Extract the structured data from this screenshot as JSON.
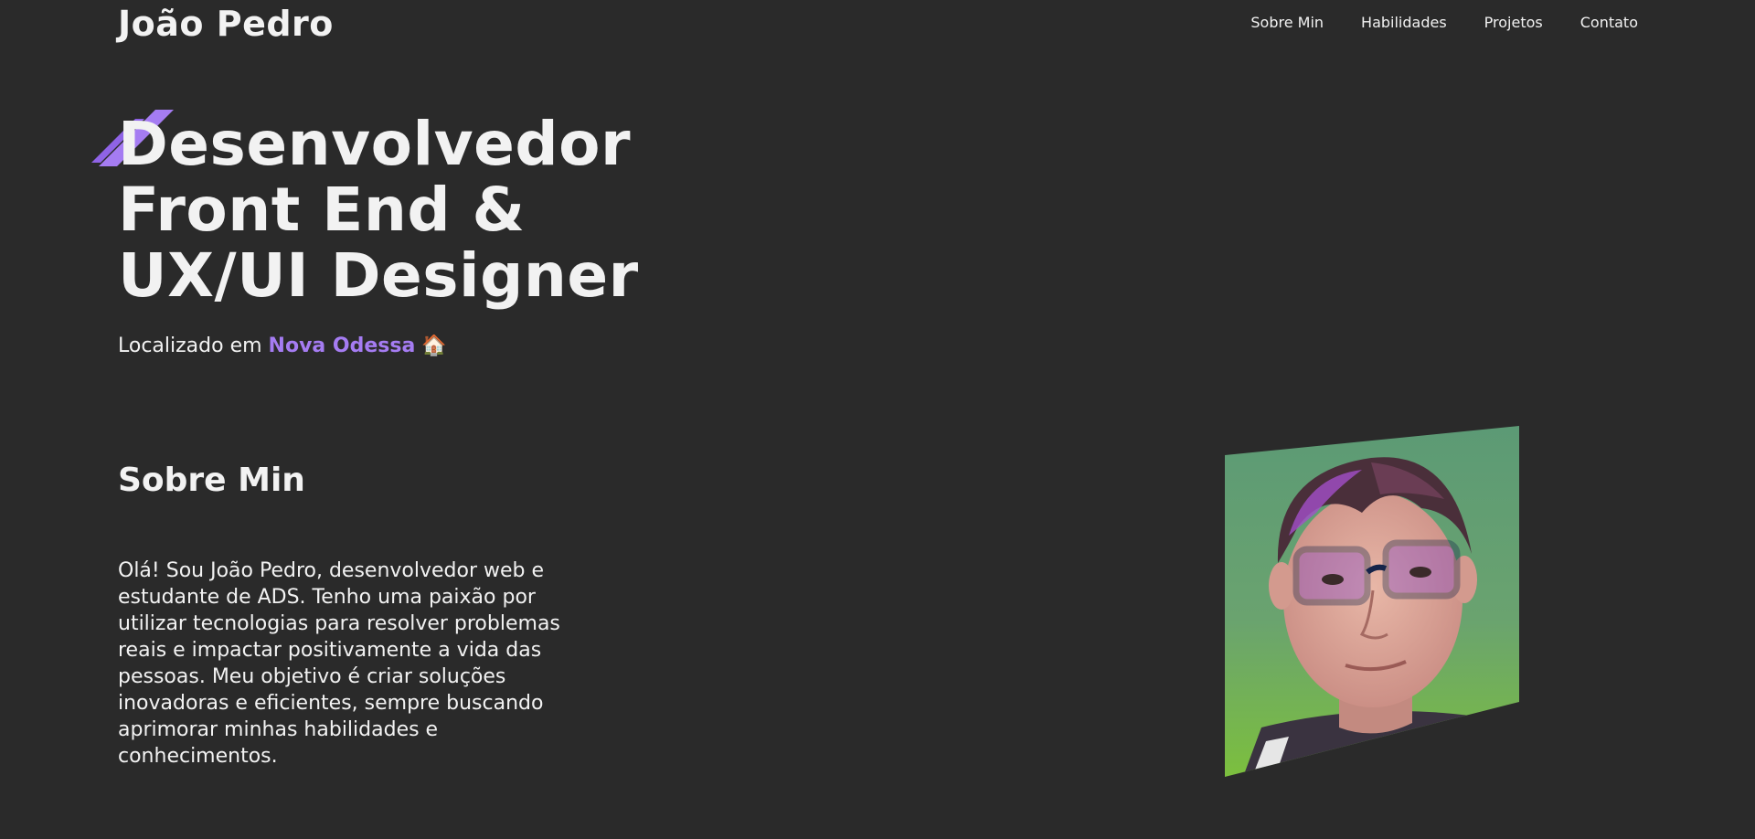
{
  "header": {
    "logo": "João Pedro",
    "nav": [
      {
        "label": "Sobre Min"
      },
      {
        "label": "Habilidades"
      },
      {
        "label": "Projetos"
      },
      {
        "label": "Contato"
      }
    ]
  },
  "hero": {
    "title_lines": [
      "Desenvolvedor",
      "Front End &",
      "UX/UI Designer"
    ],
    "location_prefix": "Localizado em",
    "location_city": "Nova Odessa",
    "location_emoji": "🏠"
  },
  "about": {
    "title": "Sobre Min",
    "text": "Olá! Sou João Pedro, desenvolvedor web e estudante de ADS. Tenho uma paixão por utilizar tecnologias para resolver problemas reais e impactar positivamente a vida das pessoas. Meu objetivo é criar soluções inovadoras e eficientes, sempre buscando aprimorar minhas habilidades e conhecimentos."
  },
  "colors": {
    "background": "#2a2a2a",
    "text": "#f2f2f2",
    "accent": "#a57cf2"
  },
  "icons": {
    "hero_accent": "diagonal-stripes-icon",
    "location": "house-icon"
  }
}
